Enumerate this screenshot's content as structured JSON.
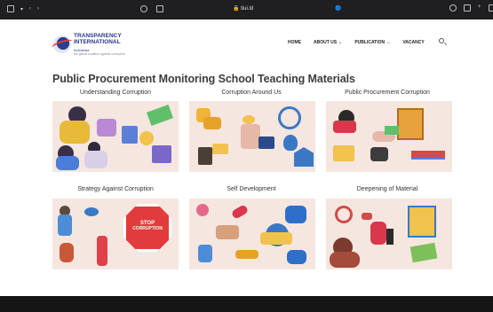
{
  "browser": {
    "address": "🔒 tiui.id",
    "tab_icon": "🔵"
  },
  "logo": {
    "line1": "TRANSPARENCY",
    "line2": "INTERNATIONAL",
    "country": "Indonesia",
    "tagline": "the global coalition against corruption"
  },
  "nav": {
    "home": "HOME",
    "about": "ABOUT US",
    "publication": "PUBLICATION",
    "vacancy": "VACANCY"
  },
  "page": {
    "title": "Public Procurement Monitoring School Teaching Materials"
  },
  "cards": [
    {
      "label": "Understanding Corruption"
    },
    {
      "label": "Corruption Around Us"
    },
    {
      "label": "Public Procurement Corruption"
    },
    {
      "label": "Strategy Against Corruption"
    },
    {
      "label": "Self Development"
    },
    {
      "label": "Deepening of Material"
    }
  ],
  "stop_sign": {
    "line1": "STOP",
    "line2": "CORRUPTION"
  },
  "colors": {
    "card_bg": "#f5e6e0",
    "brand_blue": "#2b3590",
    "brand_red": "#e23b3b",
    "footer": "#151515"
  }
}
